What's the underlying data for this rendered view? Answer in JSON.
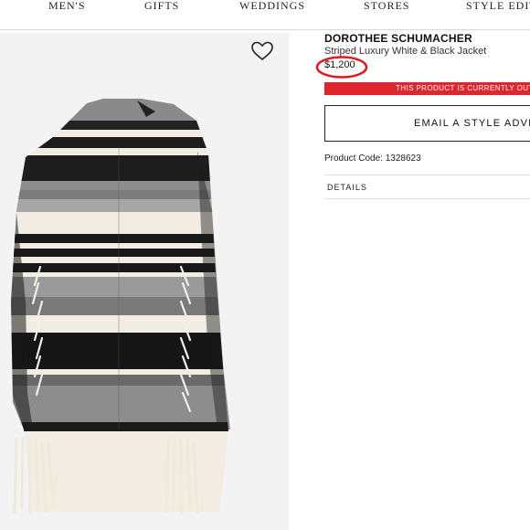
{
  "nav": {
    "items": [
      "MEN'S",
      "GIFTS",
      "WEDDINGS",
      "STORES",
      "STYLE EDIT"
    ]
  },
  "product": {
    "brand": "DOROTHEE SCHUMACHER",
    "name": "Striped Luxury White & Black Jacket",
    "price": "$1,200",
    "out_of_stock": "THIS PRODUCT IS CURRENTLY OUT",
    "email_button": "EMAIL A STYLE ADVI",
    "product_code": "Product Code: 1328623",
    "details_label": "DETAILS"
  },
  "icons": {
    "wishlist": "heart-icon"
  },
  "colors": {
    "alert_red": "#e0262d",
    "annotation_red": "#e2161f"
  }
}
